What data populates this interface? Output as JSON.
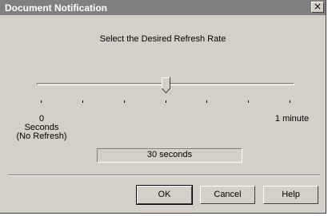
{
  "window": {
    "title": "Document Notification",
    "close_glyph": "×"
  },
  "prompt": "Select the Desired Refresh Rate",
  "slider": {
    "value_fraction": 0.5,
    "min_label": "0",
    "min_sub_label_1": "Seconds",
    "min_sub_label_2": "(No Refresh)",
    "max_label": "1 minute",
    "tick_count": 7
  },
  "current_value": "30 seconds",
  "buttons": {
    "ok": "OK",
    "cancel": "Cancel",
    "help": "Help"
  },
  "colors": {
    "titlebar": "#808080",
    "face": "#d4d0c8"
  }
}
